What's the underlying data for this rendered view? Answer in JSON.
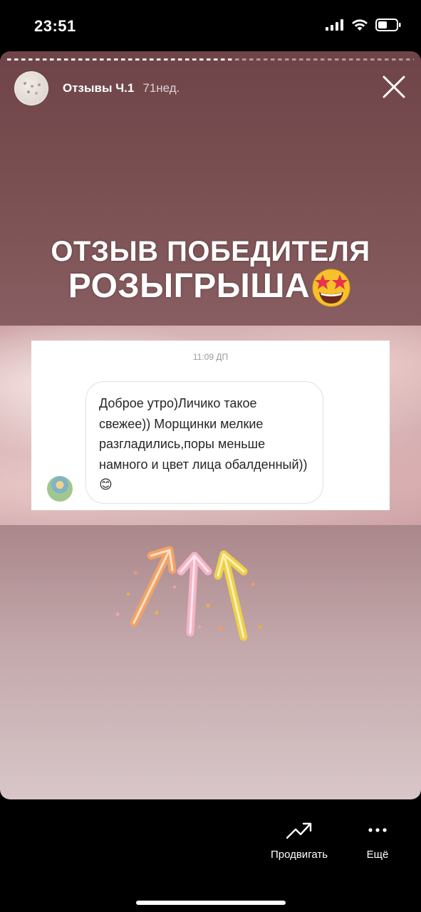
{
  "status_bar": {
    "time": "23:51"
  },
  "story": {
    "title": "Отзывы Ч.1",
    "age": "71нед.",
    "headline_line1": "ОТЗЫВ ПОБЕДИТЕЛЯ",
    "headline_line2": "РОЗЫГРЫША"
  },
  "message_card": {
    "time": "11:09 ДП",
    "text": "Доброе утро)Личико такое свежее)) Морщинки мелкие разгладились,поры меньше намного и цвет лица обалденный))😊"
  },
  "actions": {
    "promote_label": "Продвигать",
    "more_label": "Ещё"
  },
  "icons": [
    "signal-icon",
    "wifi-icon",
    "battery-icon",
    "close-icon",
    "star-struck-emoji-icon",
    "trend-up-icon",
    "more-dots-icon"
  ]
}
